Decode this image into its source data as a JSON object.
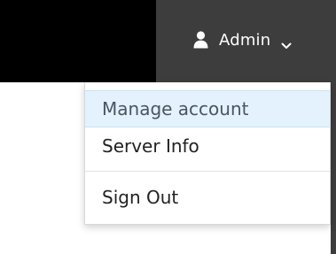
{
  "header": {
    "user_label": "Admin",
    "user_icon": "user-icon",
    "chevron_icon": "chevron-down-icon",
    "bg_dark": "#000000",
    "bg_user": "#3d3d3d"
  },
  "menu": {
    "items": [
      {
        "label": "Manage account",
        "active": true
      },
      {
        "label": "Server Info",
        "active": false
      },
      {
        "label": "Sign Out",
        "active": false
      }
    ],
    "active_color": "#e3f2fc"
  }
}
